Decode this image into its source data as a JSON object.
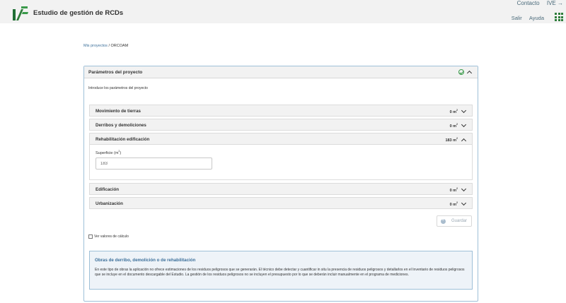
{
  "header": {
    "app_title": "Estudio de gestión de RCDs",
    "links": {
      "contact": "Contacto",
      "ive": "IVE →"
    },
    "sub_links": {
      "logout": "Salir",
      "help": "Ayuda"
    },
    "logo_icon": "ive-logo-icon",
    "apps_icon": "grid-icon"
  },
  "breadcrumb": {
    "parent": "Mis proyectos",
    "separator": " / ",
    "current": "ORCOAM"
  },
  "panel": {
    "title": "Parámetros del proyecto",
    "status_icon": "check-circle-icon",
    "intro": "Introduce los parámetros del proyecto",
    "unit_sup": "2",
    "sections": [
      {
        "label": "Movimiento de tierras",
        "value": "0 m",
        "expanded": false
      },
      {
        "label": "Derribos y demoliciones",
        "value": "0 m",
        "expanded": false
      },
      {
        "label": "Rehabilitación edificación",
        "value": "183 m",
        "expanded": true
      },
      {
        "label": "Edificación",
        "value": "0 m",
        "expanded": false
      },
      {
        "label": "Urbanización",
        "value": "0 m",
        "expanded": false
      }
    ],
    "surface": {
      "label": "Superficie (m",
      "label_sup": "2",
      "label_end": ")",
      "value": "183"
    },
    "save_label": "Guardar",
    "calc_label": "Ver valores de cálculo",
    "info": {
      "title": "Obras de derribo, demolición o de rehabilitación",
      "text": "En este tipo de obras la aplicación no ofrece estimaciones de los residuos peligrosos que se generarán. El técnico debe detectar y cuantificar in situ la presencia de residuos peligrosos y detallarlos en el Inventario de residuos peligrosos que se incluye en el documento descargable del Estudio. La gestión de los residuos peligrosos no se incluyen el presupuesto por lo que se deberán incluir manualmente en el programa de mediciones."
    }
  },
  "colors": {
    "accent_green": "#2e7d3a",
    "link_blue": "#3b6f9a",
    "info_bg": "#eef3f8"
  }
}
